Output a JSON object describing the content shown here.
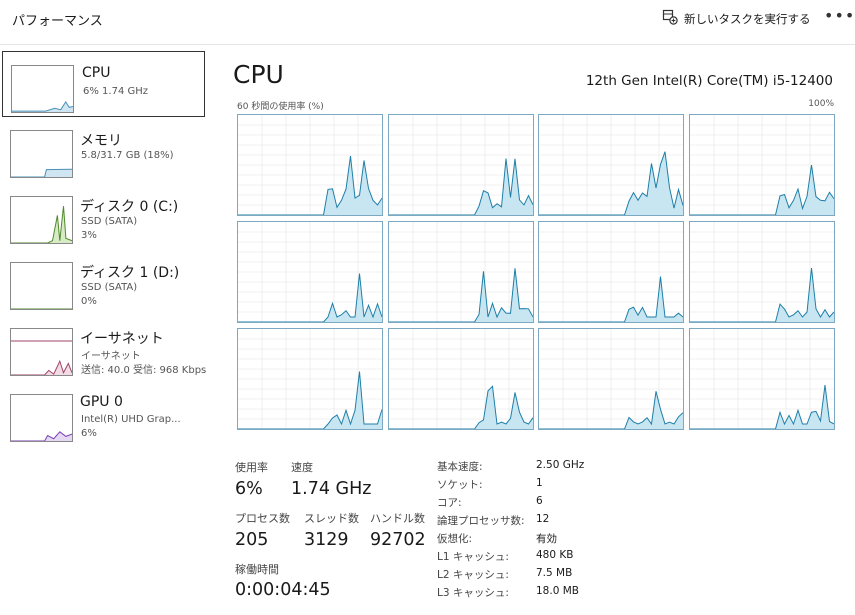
{
  "header": {
    "title": "パフォーマンス",
    "new_task_label": "新しいタスクを実行する",
    "new_task_icon": "new-task-icon",
    "more_label": "•••"
  },
  "sidebar": {
    "items": [
      {
        "name": "CPU",
        "lines": [
          "6%  1.74 GHz"
        ],
        "color": "#4a90b8",
        "fill": "#cfe6f2",
        "selected": true
      },
      {
        "name": "メモリ",
        "lines": [
          "5.8/31.7 GB (18%)"
        ],
        "color": "#4a90b8",
        "fill": "#cfe6f2"
      },
      {
        "name": "ディスク 0 (C:)",
        "lines": [
          "SSD (SATA)",
          "3%"
        ],
        "color": "#4f8a2a",
        "fill": "#d7ebc6"
      },
      {
        "name": "ディスク 1 (D:)",
        "lines": [
          "SSD (SATA)",
          "0%"
        ],
        "color": "#4f8a2a",
        "fill": "#d7ebc6"
      },
      {
        "name": "イーサネット",
        "lines": [
          "イーサネット",
          "送信: 40.0  受信: 968 Kbps"
        ],
        "color": "#a0436a",
        "fill": "#f2dbe5"
      },
      {
        "name": "GPU 0",
        "lines": [
          "Intel(R) UHD Grap...",
          "6%"
        ],
        "color": "#7a3fb5",
        "fill": "#e5d8f2"
      }
    ]
  },
  "main": {
    "title": "CPU",
    "model": "12th Gen Intel(R) Core(TM) i5-12400",
    "graph_label_left": "60 秒間の使用率 (%)",
    "graph_label_right": "100%",
    "core_color": "#1e7fa8",
    "core_fill": "#c8e6f2",
    "grid_color": "#e4e4e4"
  },
  "stats": {
    "usage_label": "使用率",
    "usage_value": "6%",
    "speed_label": "速度",
    "speed_value": "1.74 GHz",
    "processes_label": "プロセス数",
    "processes_value": "205",
    "threads_label": "スレッド数",
    "threads_value": "3129",
    "handles_label": "ハンドル数",
    "handles_value": "92702",
    "uptime_label": "稼働時間",
    "uptime_value": "0:00:04:45"
  },
  "specs": [
    {
      "label": "基本速度:",
      "value": "2.50 GHz"
    },
    {
      "label": "ソケット:",
      "value": "1"
    },
    {
      "label": "コア:",
      "value": "6"
    },
    {
      "label": "論理プロセッサ数:",
      "value": "12"
    },
    {
      "label": "仮想化:",
      "value": "有効"
    },
    {
      "label": "L1 キャッシュ:",
      "value": "480 KB"
    },
    {
      "label": "L2 キャッシュ:",
      "value": "7.5 MB"
    },
    {
      "label": "L3 キャッシュ:",
      "value": "18.0 MB"
    }
  ]
}
